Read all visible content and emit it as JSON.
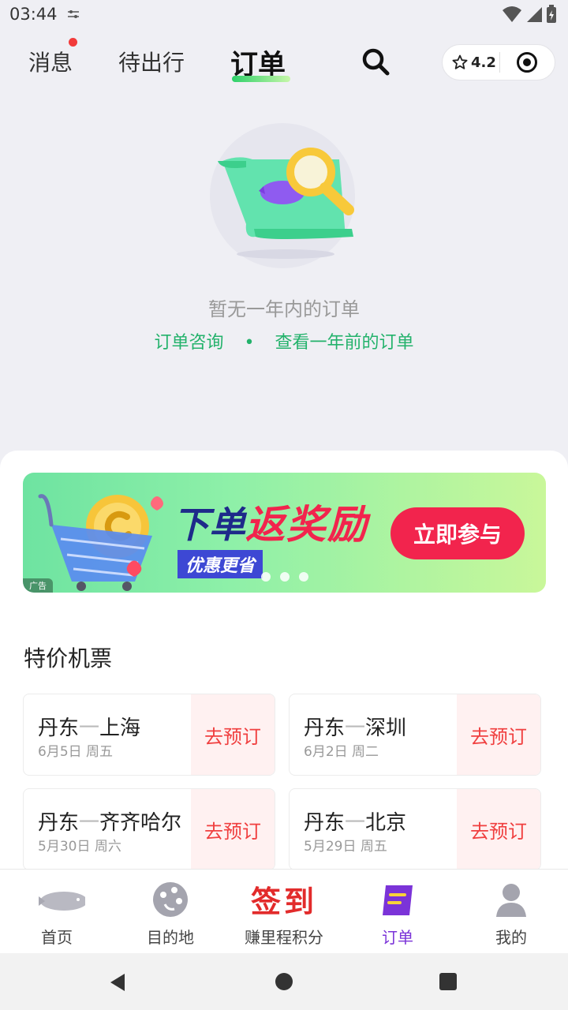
{
  "status_bar": {
    "time": "03:44"
  },
  "top_nav": {
    "tabs": [
      "消息",
      "待出行",
      "订单"
    ],
    "rating": "4.2"
  },
  "empty_state": {
    "message": "暂无一年内的订单",
    "link_consult": "订单咨询",
    "separator": "•",
    "link_history": "查看一年前的订单"
  },
  "banner": {
    "title_a": "下单",
    "title_b": "返奖励",
    "subtitle": "优惠更省",
    "cta": "立即参与",
    "ad_tag": "广告"
  },
  "deals": {
    "title": "特价机票",
    "items": [
      {
        "from": "丹东",
        "to": "上海",
        "date": "6月5日 周五",
        "action": "去预订"
      },
      {
        "from": "丹东",
        "to": "深圳",
        "date": "6月2日 周二",
        "action": "去预订"
      },
      {
        "from": "丹东",
        "to": "齐齐哈尔",
        "date": "5月30日 周六",
        "action": "去预订"
      },
      {
        "from": "丹东",
        "to": "北京",
        "date": "5月29日 周五",
        "action": "去预订"
      }
    ]
  },
  "tabbar": {
    "items": [
      "首页",
      "目的地",
      "赚里程积分",
      "订单",
      "我的"
    ],
    "checkin": "签到",
    "active_color": "#7b33d8"
  }
}
